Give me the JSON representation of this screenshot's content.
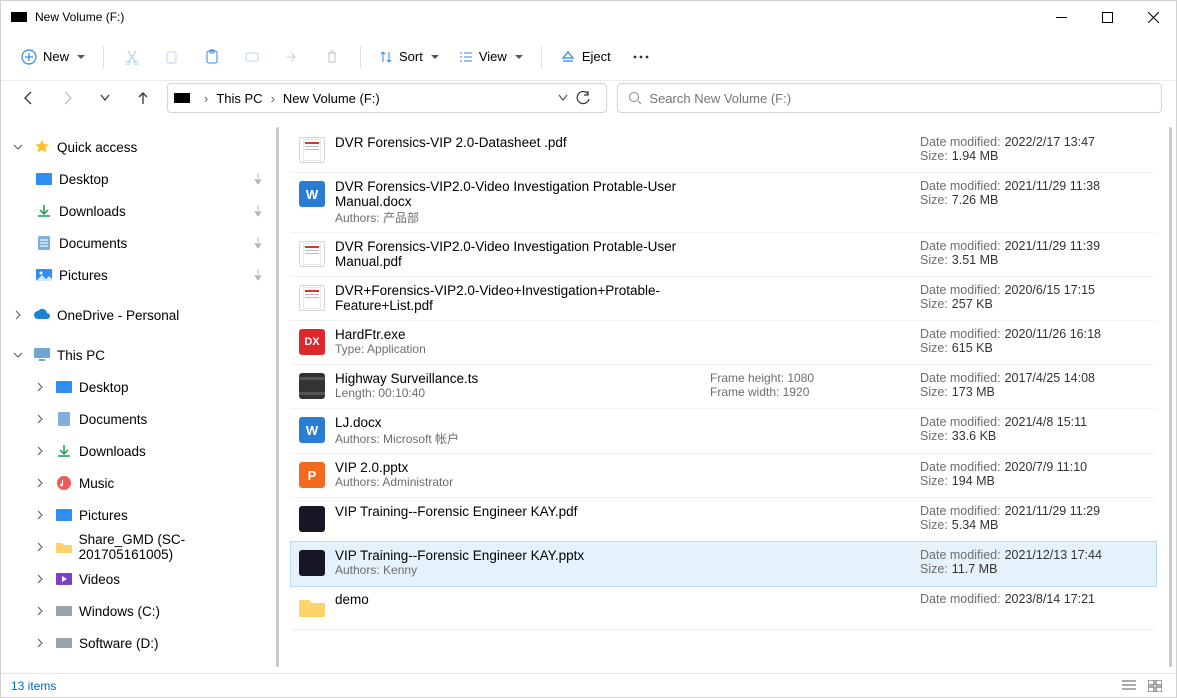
{
  "window": {
    "title": "New Volume (F:)"
  },
  "toolbar": {
    "new": "New",
    "sort": "Sort",
    "view": "View",
    "eject": "Eject"
  },
  "breadcrumb": {
    "root": "This PC",
    "leaf": "New Volume (F:)"
  },
  "search": {
    "placeholder": "Search New Volume (F:)"
  },
  "sidebar": {
    "quickaccess": "Quick access",
    "desktop": "Desktop",
    "downloads": "Downloads",
    "documents": "Documents",
    "pictures": "Pictures",
    "onedrive": "OneDrive - Personal",
    "thispc": "This PC",
    "pc_desktop": "Desktop",
    "pc_documents": "Documents",
    "pc_downloads": "Downloads",
    "pc_music": "Music",
    "pc_pictures": "Pictures",
    "pc_share": "Share_GMD (SC-201705161005)",
    "pc_videos": "Videos",
    "pc_windows": "Windows (C:)",
    "pc_software": "Software (D:)"
  },
  "labels": {
    "date_modified": "Date modified:",
    "size": "Size:",
    "authors": "Authors:",
    "type": "Type:",
    "length": "Length:",
    "frame_height": "Frame height:",
    "frame_width": "Frame width:"
  },
  "files": [
    {
      "name": "DVR Forensics-VIP 2.0-Datasheet .pdf",
      "icon": "pdf",
      "date": "2022/2/17 13:47",
      "size": "1.94 MB"
    },
    {
      "name": "DVR Forensics-VIP2.0-Video Investigation Protable-User Manual.docx",
      "icon": "word",
      "authors": "产品部",
      "date": "2021/11/29 11:38",
      "size": "7.26 MB"
    },
    {
      "name": "DVR Forensics-VIP2.0-Video Investigation Protable-User Manual.pdf",
      "icon": "pdf",
      "date": "2021/11/29 11:39",
      "size": "3.51 MB"
    },
    {
      "name": "DVR+Forensics-VIP2.0-Video+Investigation+Protable-Feature+List.pdf",
      "icon": "pdf",
      "date": "2020/6/15 17:15",
      "size": "257 KB"
    },
    {
      "name": "HardFtr.exe",
      "icon": "dx",
      "type": "Application",
      "date": "2020/11/26 16:18",
      "size": "615 KB"
    },
    {
      "name": "Highway Surveillance.ts",
      "icon": "ts",
      "length": "00:10:40",
      "fh": "1080",
      "fw": "1920",
      "date": "2017/4/25 14:08",
      "size": "173 MB"
    },
    {
      "name": "LJ.docx",
      "icon": "word",
      "authors": "Microsoft 帐户",
      "date": "2021/4/8 15:11",
      "size": "33.6 KB"
    },
    {
      "name": "VIP 2.0.pptx",
      "icon": "pp",
      "authors": "Administrator",
      "date": "2020/7/9 11:10",
      "size": "194 MB"
    },
    {
      "name": "VIP Training--Forensic Engineer KAY.pdf",
      "icon": "dark",
      "date": "2021/11/29 11:29",
      "size": "5.34 MB"
    },
    {
      "name": "VIP Training--Forensic Engineer KAY.pptx",
      "icon": "dark",
      "authors": "Kenny",
      "date": "2021/12/13 17:44",
      "size": "11.7 MB",
      "selected": true
    },
    {
      "name": "demo",
      "icon": "folder",
      "date": "2023/8/14 17:21"
    }
  ],
  "status": {
    "count": "13 items"
  }
}
